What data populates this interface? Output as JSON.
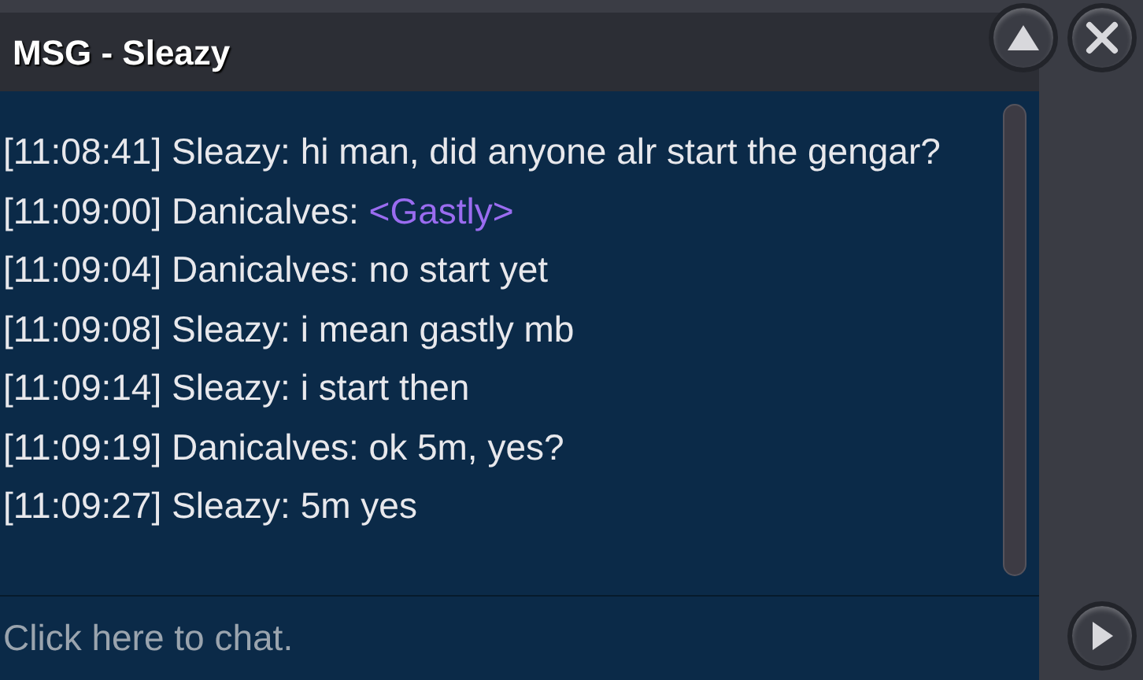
{
  "window": {
    "title": "MSG - Sleazy"
  },
  "messages": [
    {
      "time": "[11:08:41]",
      "sender": "Sleazy:",
      "text": "hi man, did anyone alr start the gengar?",
      "kind": "plain"
    },
    {
      "time": "[11:09:00]",
      "sender": "Danicalves:",
      "text": "<Gastly>",
      "kind": "link"
    },
    {
      "time": "[11:09:04]",
      "sender": "Danicalves:",
      "text": "no start yet",
      "kind": "plain"
    },
    {
      "time": "[11:09:08]",
      "sender": "Sleazy:",
      "text": "i mean gastly mb",
      "kind": "plain"
    },
    {
      "time": "[11:09:14]",
      "sender": "Sleazy:",
      "text": "i start then",
      "kind": "plain"
    },
    {
      "time": "[11:09:19]",
      "sender": "Danicalves:",
      "text": "ok 5m, yes?",
      "kind": "plain"
    },
    {
      "time": "[11:09:27]",
      "sender": "Sleazy:",
      "text": "5m yes",
      "kind": "plain"
    }
  ],
  "chat_input": {
    "placeholder": "Click here to chat."
  }
}
